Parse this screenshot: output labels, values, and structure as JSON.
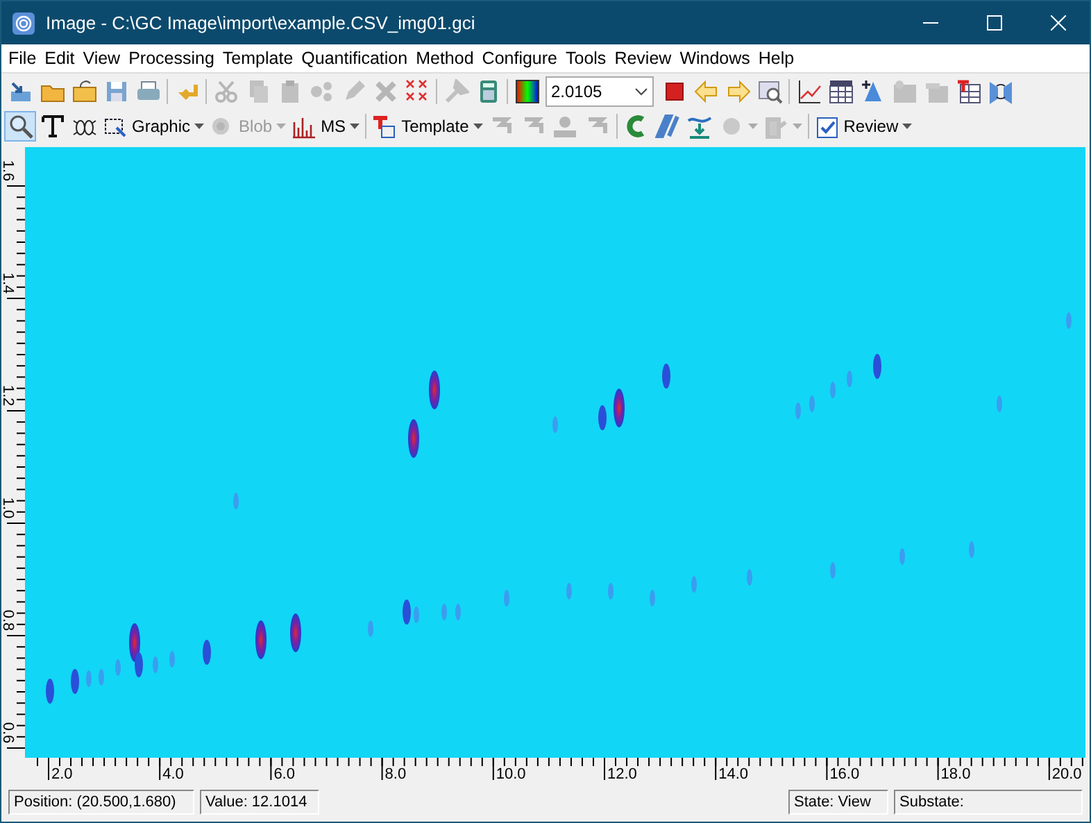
{
  "window": {
    "title": "Image - C:\\GC Image\\import\\example.CSV_img01.gci"
  },
  "menu": [
    "File",
    "Edit",
    "View",
    "Processing",
    "Template",
    "Quantification",
    "Method",
    "Configure",
    "Tools",
    "Review",
    "Windows",
    "Help"
  ],
  "toolbar_1": {
    "buttons": [
      {
        "disabled": false
      },
      {
        "disabled": false
      },
      {
        "disabled": false
      },
      {
        "disabled": false
      },
      {
        "disabled": false
      },
      {
        "disabled": false
      },
      {
        "disabled": true
      },
      {
        "disabled": true
      },
      {
        "disabled": true
      },
      {
        "disabled": true
      },
      {
        "disabled": true
      },
      {
        "disabled": true
      },
      {
        "disabled": false
      },
      {
        "disabled": true
      },
      {
        "disabled": false
      },
      {
        "disabled": false
      }
    ],
    "zoom_value": "2.0105",
    "buttons_after": [
      {
        "disabled": false
      },
      {
        "disabled": false
      },
      {
        "disabled": false
      },
      {
        "disabled": false
      },
      {
        "disabled": false
      },
      {
        "disabled": false
      },
      {
        "disabled": false
      },
      {
        "disabled": true
      },
      {
        "disabled": true
      },
      {
        "disabled": false
      },
      {
        "disabled": false
      }
    ]
  },
  "toolbar_2": {
    "items": [
      {
        "kind": "tool",
        "selected": true,
        "disabled": false
      },
      {
        "kind": "tool",
        "selected": false,
        "disabled": false
      },
      {
        "kind": "tool",
        "selected": false,
        "disabled": false
      },
      {
        "kind": "dropdown",
        "label": "Graphic",
        "disabled": false
      },
      {
        "kind": "dropdown",
        "label": "Blob",
        "disabled": true
      },
      {
        "kind": "dropdown",
        "label": "MS",
        "disabled": false
      },
      {
        "kind": "dropdown",
        "label": "Template",
        "disabled": false
      },
      {
        "kind": "tool",
        "selected": false,
        "disabled": true
      },
      {
        "kind": "tool",
        "selected": false,
        "disabled": true
      },
      {
        "kind": "tool",
        "selected": false,
        "disabled": true
      },
      {
        "kind": "tool",
        "selected": false,
        "disabled": true
      },
      {
        "kind": "tool",
        "selected": false,
        "disabled": false
      },
      {
        "kind": "tool",
        "selected": false,
        "disabled": false
      },
      {
        "kind": "tool",
        "selected": false,
        "disabled": false
      },
      {
        "kind": "dropdown",
        "disabled": true
      },
      {
        "kind": "dropdown",
        "disabled": true
      },
      {
        "kind": "dropdown",
        "label": "Review",
        "disabled": false
      }
    ]
  },
  "plot": {
    "y_ticks": [
      "1.6",
      "1.4",
      "1.2",
      "1.0",
      "0.8",
      "0.6"
    ],
    "x_ticks": [
      "2.0",
      "4.0",
      "6.0",
      "8.0",
      "10.0",
      "12.0",
      "14.0",
      "16.0",
      "18.0",
      "20.0"
    ]
  },
  "status_bar": {
    "position": "Position: (20.500,1.680)",
    "value": "Value: 12.1014",
    "state": "State: View",
    "substate": "Substate:"
  }
}
